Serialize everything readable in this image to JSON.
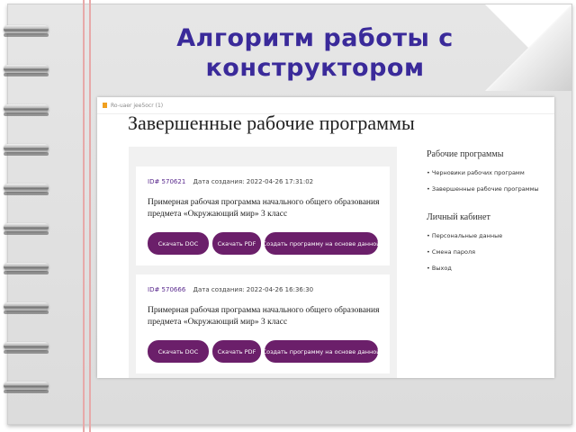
{
  "slide": {
    "title_line1": "Алгоритм работы с",
    "title_line2": "конструктором"
  },
  "browser": {
    "tab_label": "Ro-uaer jee5ocr (1)"
  },
  "page": {
    "title": "Завершенные рабочие программы",
    "programs": [
      {
        "id": "ID# 570621",
        "date": "Дата создания: 2022-04-26 17:31:02",
        "description": "Примерная рабочая программа начального общего образования предмета «Окружающий мир» 3 класс",
        "btn_doc": "Скачать DOC",
        "btn_pdf": "Скачать PDF",
        "btn_create": "Создать программу на основе данной"
      },
      {
        "id": "ID# 570666",
        "date": "Дата создания: 2022-04-26 16:36:30",
        "description": "Примерная рабочая программа начального общего образования предмета «Окружающий мир» 3 класс",
        "btn_doc": "Скачать DOC",
        "btn_pdf": "Скачать PDF",
        "btn_create": "Создать программу на основе данной"
      }
    ]
  },
  "sidebar": {
    "section1_heading": "Рабочие программы",
    "section1_items": [
      "• Черновики рабочих программ",
      "• Завершенные рабочие программы"
    ],
    "section2_heading": "Личный кабинет",
    "section2_items": [
      "• Персональные данные",
      "• Смена пароля",
      "• Выход"
    ]
  },
  "colors": {
    "title": "#3a2a9a",
    "button": "#6b1f6a",
    "id_text": "#5a2a8e"
  }
}
